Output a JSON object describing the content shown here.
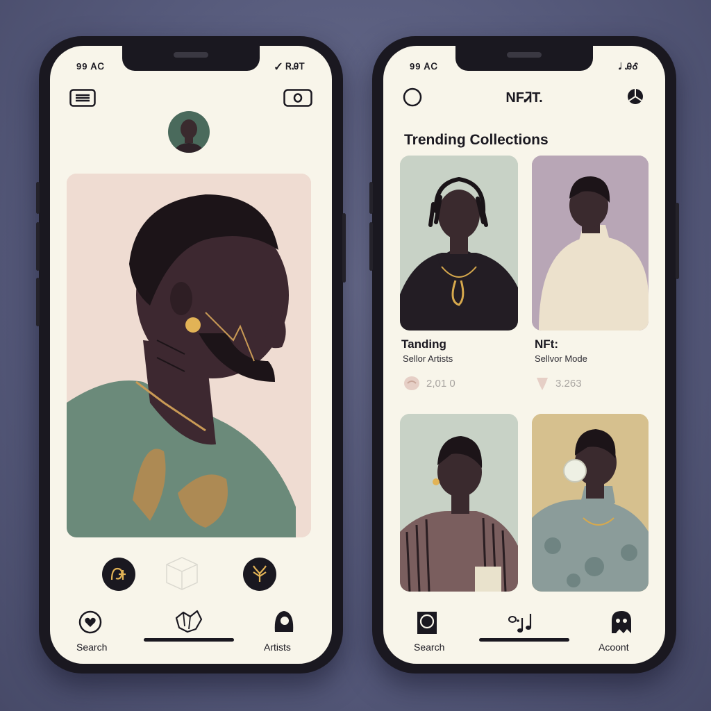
{
  "left_phone": {
    "status_left": "99 ᎪᏟ",
    "status_right": "✓ ᏒᎯᎢ",
    "menu_icon": "menu-icon",
    "camera_icon": "camera-icon",
    "avatar_icon": "avatar",
    "hero_alt": "portrait-artwork",
    "action_icons": [
      "monogram-button",
      "box-icon",
      "tree-button"
    ],
    "tabs": [
      {
        "label": "Search",
        "icon": "heart-icon"
      },
      {
        "label": "",
        "icon": "map-icon"
      },
      {
        "label": "Artists",
        "icon": "artist-icon"
      }
    ]
  },
  "right_phone": {
    "status_left": "99 ᎪᏟ",
    "status_right": "𝅘𝅥 ᎯᎴ",
    "title": "NFᏘT.",
    "section_title": "Trending Collections",
    "cards": [
      {
        "title": "Tanding",
        "subtitle": "Sellor Artists",
        "stat": "2,01 0"
      },
      {
        "title": "NFt:",
        "subtitle": "Sellvor Mode",
        "stat": "3.263"
      },
      {
        "title": "",
        "subtitle": "",
        "stat": ""
      },
      {
        "title": "",
        "subtitle": "",
        "stat": ""
      }
    ],
    "tabs": [
      {
        "label": "Search",
        "icon": "square-icon"
      },
      {
        "label": "",
        "icon": "music-icon"
      },
      {
        "label": "Acoont",
        "icon": "ghost-icon"
      }
    ]
  },
  "colors": {
    "screen_bg": "#f8f5ea",
    "phone_frame": "#1a1820",
    "background": "#55597a"
  }
}
